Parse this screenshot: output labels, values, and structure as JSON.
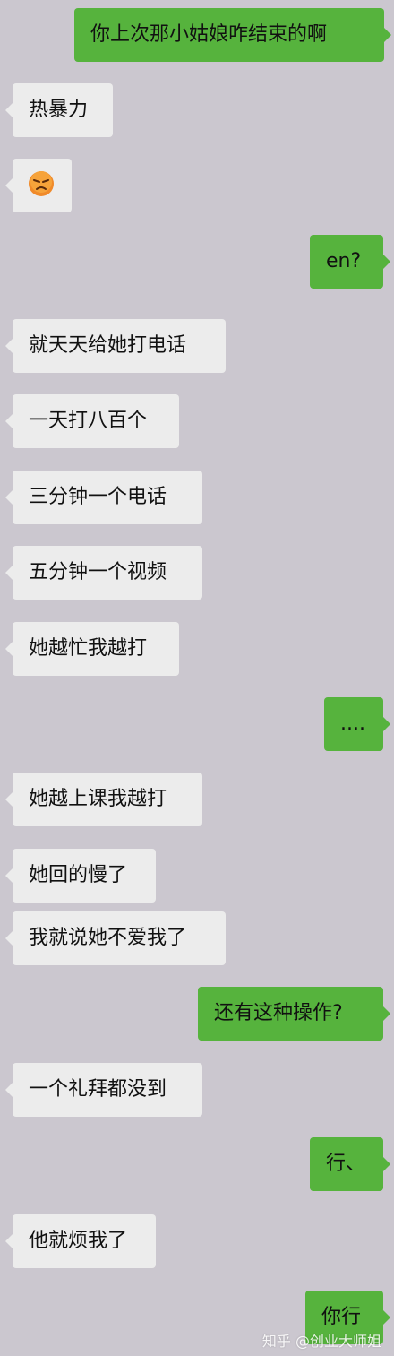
{
  "messages": [
    {
      "side": "right",
      "text": "你上次那小姑娘咋结束的啊"
    },
    {
      "side": "left",
      "text": "热暴力"
    },
    {
      "side": "left",
      "emoji": "angry-face-emoji"
    },
    {
      "side": "right",
      "text": "en?"
    },
    {
      "side": "left",
      "text": "就天天给她打电话"
    },
    {
      "side": "left",
      "text": "一天打八百个"
    },
    {
      "side": "left",
      "text": "三分钟一个电话"
    },
    {
      "side": "left",
      "text": "五分钟一个视频"
    },
    {
      "side": "left",
      "text": "她越忙我越打"
    },
    {
      "side": "right",
      "text": "...."
    },
    {
      "side": "left",
      "text": "她越上课我越打"
    },
    {
      "side": "left",
      "text": "她回的慢了"
    },
    {
      "side": "left",
      "text": "我就说她不爱我了"
    },
    {
      "side": "right",
      "text": "还有这种操作?"
    },
    {
      "side": "left",
      "text": "一个礼拜都没到"
    },
    {
      "side": "right",
      "text": "行、"
    },
    {
      "side": "left",
      "text": "他就烦我了"
    },
    {
      "side": "right",
      "text": "你行"
    }
  ],
  "watermark": "知乎 @创业大师姐",
  "colors": {
    "background": "#cbc7cf",
    "sent_bubble": "#56b33d",
    "received_bubble": "#ececec"
  }
}
